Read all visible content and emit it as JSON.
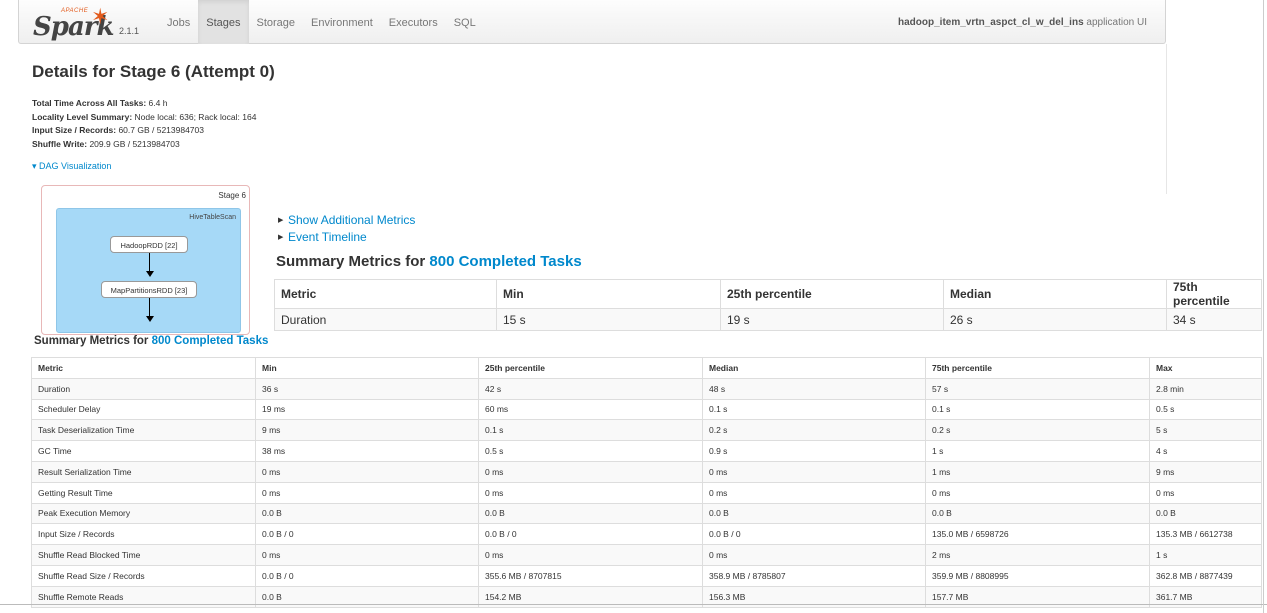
{
  "nav": {
    "brand_name": "Spark",
    "brand_prefix": "APACHE",
    "version": "2.1.1",
    "links": [
      "Jobs",
      "Stages",
      "Storage",
      "Environment",
      "Executors",
      "SQL"
    ],
    "active": "Stages",
    "app_name": "hadoop_item_vrtn_aspct_cl_w_del_ins",
    "app_suffix": " application UI"
  },
  "page": {
    "title": "Details for Stage 6 (Attempt 0)",
    "info": [
      {
        "label": "Total Time Across All Tasks:",
        "value": " 6.4 h"
      },
      {
        "label": "Locality Level Summary:",
        "value": " Node local: 636; Rack local: 164"
      },
      {
        "label": "Input Size / Records:",
        "value": " 60.7 GB / 5213984703"
      },
      {
        "label": "Shuffle Write:",
        "value": " 209.9 GB / 5213984703"
      }
    ],
    "dag_toggle": "▾ DAG Visualization"
  },
  "dag": {
    "stage_label": "Stage 6",
    "cluster_label": "HiveTableScan",
    "nodes": [
      "HadoopRDD [22]",
      "MapPartitionsRDD [23]"
    ]
  },
  "toggles": {
    "additional_metrics": "Show Additional Metrics",
    "event_timeline": "Event Timeline"
  },
  "big_summary": {
    "title_prefix": "Summary Metrics for ",
    "title_link": "800 Completed Tasks",
    "headers": [
      "Metric",
      "Min",
      "25th percentile",
      "Median",
      "75th percentile"
    ],
    "row": [
      "Duration",
      "15 s",
      "19 s",
      "26 s",
      "34 s"
    ]
  },
  "summary": {
    "title_prefix": "Summary Metrics for ",
    "title_link": "800 Completed Tasks",
    "headers": [
      "Metric",
      "Min",
      "25th percentile",
      "Median",
      "75th percentile",
      "Max"
    ],
    "rows": [
      [
        "Duration",
        "36 s",
        "42 s",
        "48 s",
        "57 s",
        "2.8 min"
      ],
      [
        "Scheduler Delay",
        "19 ms",
        "60 ms",
        "0.1 s",
        "0.1 s",
        "0.5 s"
      ],
      [
        "Task Deserialization Time",
        "9 ms",
        "0.1 s",
        "0.2 s",
        "0.2 s",
        "5 s"
      ],
      [
        "GC Time",
        "38 ms",
        "0.5 s",
        "0.9 s",
        "1 s",
        "4 s"
      ],
      [
        "Result Serialization Time",
        "0 ms",
        "0 ms",
        "0 ms",
        "1 ms",
        "9 ms"
      ],
      [
        "Getting Result Time",
        "0 ms",
        "0 ms",
        "0 ms",
        "0 ms",
        "0 ms"
      ],
      [
        "Peak Execution Memory",
        "0.0 B",
        "0.0 B",
        "0.0 B",
        "0.0 B",
        "0.0 B"
      ],
      [
        "Input Size / Records",
        "0.0 B / 0",
        "0.0 B / 0",
        "0.0 B / 0",
        "135.0 MB / 6598726",
        "135.3 MB / 6612738"
      ],
      [
        "Shuffle Read Blocked Time",
        "0 ms",
        "0 ms",
        "0 ms",
        "2 ms",
        "1 s"
      ],
      [
        "Shuffle Read Size / Records",
        "0.0 B / 0",
        "355.6 MB / 8707815",
        "358.9 MB / 8785807",
        "359.9 MB / 8808995",
        "362.8 MB / 8877439"
      ],
      [
        "Shuffle Remote Reads",
        "0.0 B",
        "154.2 MB",
        "156.3 MB",
        "157.7 MB",
        "361.7 MB"
      ]
    ]
  },
  "colors": {
    "link": "#0088cc",
    "spark_orange": "#e25a1c",
    "dag_cluster": "#a6d9f7"
  }
}
